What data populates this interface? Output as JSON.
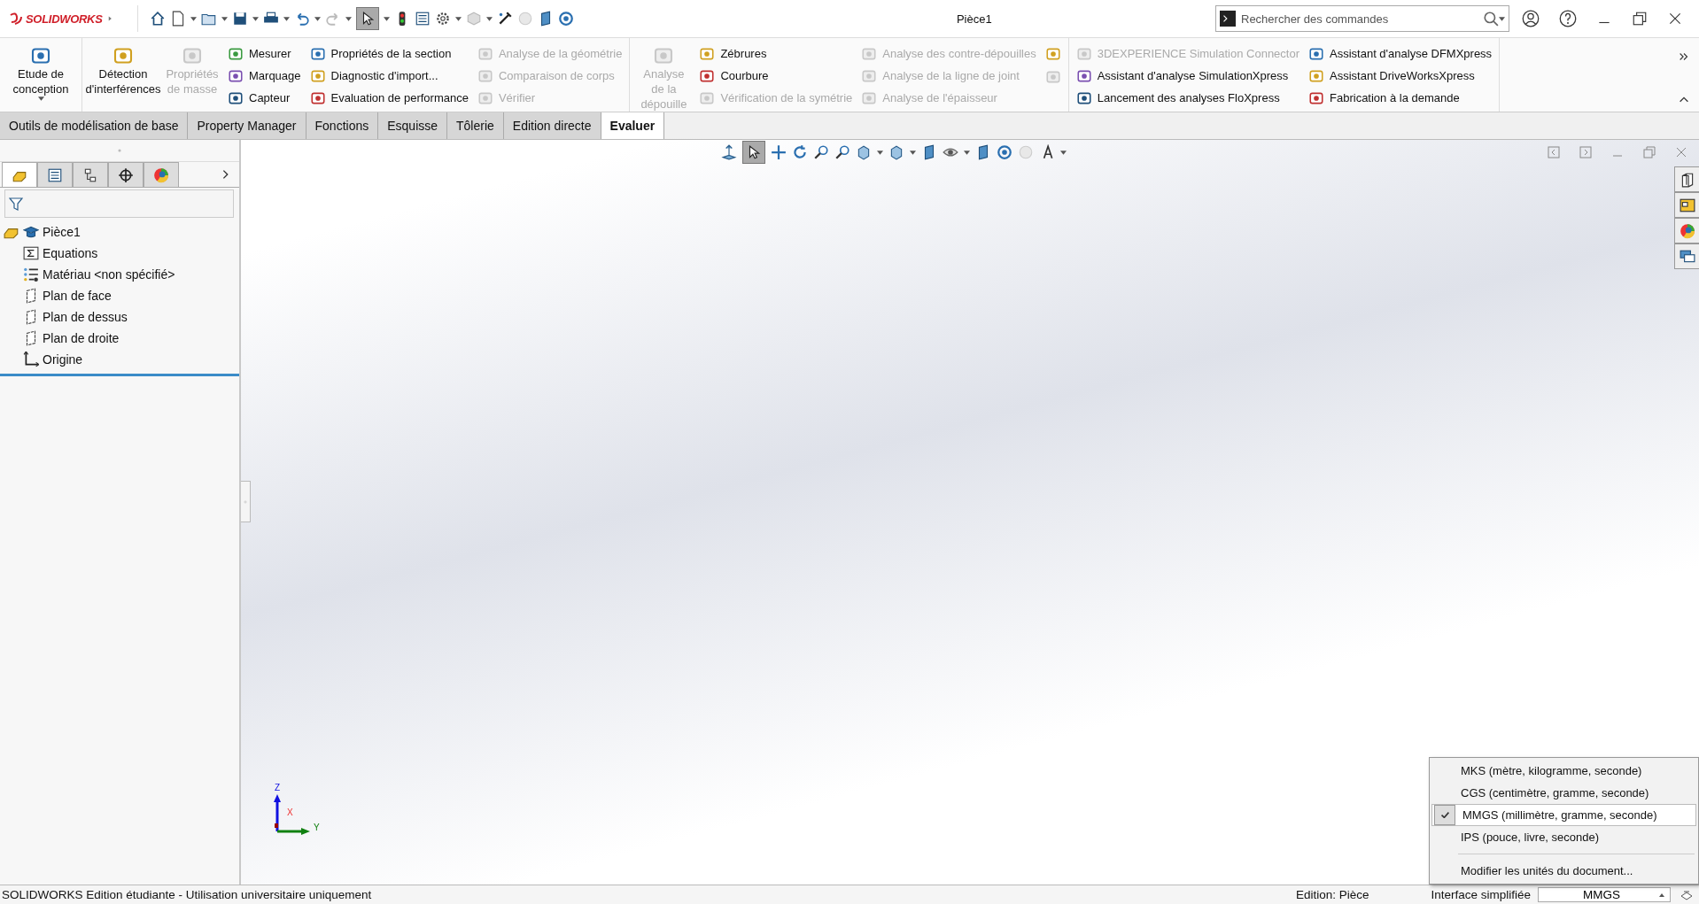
{
  "app": {
    "logo": "SOLIDWORKS",
    "title": "Pièce1",
    "search": {
      "placeholder": "Rechercher des commandes"
    }
  },
  "ribbon": {
    "groups": [
      {
        "columns": [
          {
            "kind": "large",
            "items": [
              {
                "label": "Etude de conception",
                "disabled": false,
                "menu": true
              }
            ]
          }
        ]
      },
      {
        "columns": [
          {
            "kind": "large",
            "items": [
              {
                "label": "Détection d'interférences",
                "disabled": false
              }
            ]
          },
          {
            "kind": "large",
            "items": [
              {
                "label": "Propriétés de masse",
                "disabled": true
              }
            ]
          },
          {
            "kind": "stack",
            "items": [
              {
                "label": "Mesurer",
                "disabled": false
              },
              {
                "label": "Marquage",
                "disabled": false
              },
              {
                "label": "Capteur",
                "disabled": false
              }
            ]
          },
          {
            "kind": "stack",
            "items": [
              {
                "label": "Propriétés de la section",
                "disabled": false
              },
              {
                "label": "Diagnostic d'import...",
                "disabled": false
              },
              {
                "label": "Evaluation de performance",
                "disabled": false
              }
            ]
          },
          {
            "kind": "stack",
            "items": [
              {
                "label": "Analyse de la géométrie",
                "disabled": true
              },
              {
                "label": "Comparaison de corps",
                "disabled": true
              },
              {
                "label": "Vérifier",
                "disabled": true
              }
            ]
          }
        ]
      },
      {
        "columns": [
          {
            "kind": "large",
            "items": [
              {
                "label": "Analyse de la dépouille",
                "disabled": true
              }
            ]
          },
          {
            "kind": "stack",
            "items": [
              {
                "label": "Zébrures",
                "disabled": false
              },
              {
                "label": "Courbure",
                "disabled": false
              },
              {
                "label": "Vérification de la symétrie",
                "disabled": true
              }
            ]
          },
          {
            "kind": "stack",
            "items": [
              {
                "label": "Analyse des contre-dépouilles",
                "disabled": true
              },
              {
                "label": "Analyse de la ligne de joint",
                "disabled": true
              },
              {
                "label": "Analyse de l'épaisseur",
                "disabled": true
              }
            ]
          },
          {
            "kind": "icons",
            "items": [
              {
                "disabled": false
              },
              {
                "disabled": true
              }
            ]
          }
        ]
      },
      {
        "columns": [
          {
            "kind": "stack",
            "items": [
              {
                "label": "3DEXPERIENCE Simulation Connector",
                "disabled": true
              },
              {
                "label": "Assistant d'analyse SimulationXpress",
                "disabled": false
              },
              {
                "label": "Lancement des analyses FloXpress",
                "disabled": false
              }
            ]
          },
          {
            "kind": "stack",
            "items": [
              {
                "label": "Assistant d'analyse DFMXpress",
                "disabled": false
              },
              {
                "label": "Assistant DriveWorksXpress",
                "disabled": false
              },
              {
                "label": "Fabrication à la demande",
                "disabled": false
              }
            ]
          }
        ]
      }
    ]
  },
  "tabs": [
    {
      "label": "Outils de modélisation de base",
      "selected": false
    },
    {
      "label": "Property Manager",
      "selected": false
    },
    {
      "label": "Fonctions",
      "selected": false
    },
    {
      "label": "Esquisse",
      "selected": false
    },
    {
      "label": "Tôlerie",
      "selected": false
    },
    {
      "label": "Edition directe",
      "selected": false
    },
    {
      "label": "Evaluer",
      "selected": true
    }
  ],
  "feature_tree": {
    "panel_tabs": [
      {
        "selected": true
      },
      {
        "selected": false
      },
      {
        "selected": false
      },
      {
        "selected": false
      },
      {
        "selected": false
      }
    ],
    "root": {
      "label": "Pièce1",
      "children": [
        {
          "kind": "equations",
          "label": "Equations"
        },
        {
          "kind": "material",
          "label": "Matériau <non spécifié>"
        },
        {
          "kind": "plane",
          "label": "Plan de face"
        },
        {
          "kind": "plane",
          "label": "Plan de dessus"
        },
        {
          "kind": "plane",
          "label": "Plan de droite"
        },
        {
          "kind": "origin",
          "label": "Origine"
        }
      ]
    }
  },
  "triad": {
    "z": "Z",
    "y": "Y",
    "x": "X"
  },
  "units_menu": {
    "items": [
      {
        "label": "MKS (mètre, kilogramme, seconde)",
        "checked": false
      },
      {
        "label": "CGS (centimètre, gramme, seconde)",
        "checked": false
      },
      {
        "label": "MMGS (millimètre, gramme, seconde)",
        "checked": true
      },
      {
        "label": "IPS (pouce, livre, seconde)",
        "checked": false
      }
    ],
    "footer": "Modifier les unités du document..."
  },
  "status_bar": {
    "text": "SOLIDWORKS Edition étudiante - Utilisation universitaire uniquement",
    "mode": "Edition: Pièce",
    "interface": "Interface simplifiée",
    "units": "MMGS"
  }
}
